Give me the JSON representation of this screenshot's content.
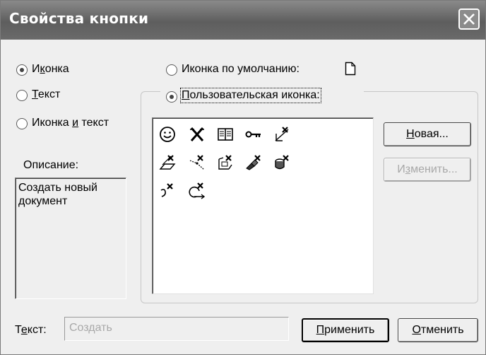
{
  "window": {
    "title": "Свойства кнопки"
  },
  "mode_options": [
    {
      "pre": "И",
      "ul": "к",
      "post": "онка",
      "selected": true
    },
    {
      "pre": "",
      "ul": "Т",
      "post": "екст",
      "selected": false
    },
    {
      "pre": "Иконка ",
      "ul": "и",
      "post": " текст",
      "selected": false
    }
  ],
  "icon_source": {
    "default_label": "Иконка по умолчанию:",
    "default_selected": false,
    "custom_label": "Пользовательская иконка:",
    "custom_selected": true,
    "custom_ul": "П",
    "custom_rest": "ользовательская иконка:"
  },
  "icons": [
    "smiley-icon",
    "cross-tool-icon",
    "book-icon",
    "key-icon",
    "axis-cross-icon",
    "plane-cross-icon",
    "line-cross-icon",
    "frame-cross-icon",
    "brush-cross-icon",
    "cylinder-cross-icon",
    "spiral-cross-icon",
    "rotate-cross-icon"
  ],
  "buttons": {
    "new_ul": "Н",
    "new_rest": "овая...",
    "edit_pre": "И",
    "edit_ul": "з",
    "edit_rest": "менить...",
    "apply_ul": "П",
    "apply_rest": "рименить",
    "cancel_ul": "О",
    "cancel_rest": "тменить"
  },
  "description": {
    "label": "Описание:",
    "text": "Создать новый документ"
  },
  "text_field": {
    "label_pre": "Т",
    "label_ul": "е",
    "label_post": "кст:",
    "value": "Создать"
  },
  "colors": {
    "titlebar": "#6b6b6b",
    "dialog_bg": "#efefef",
    "disabled_text": "#a8a8a8"
  }
}
